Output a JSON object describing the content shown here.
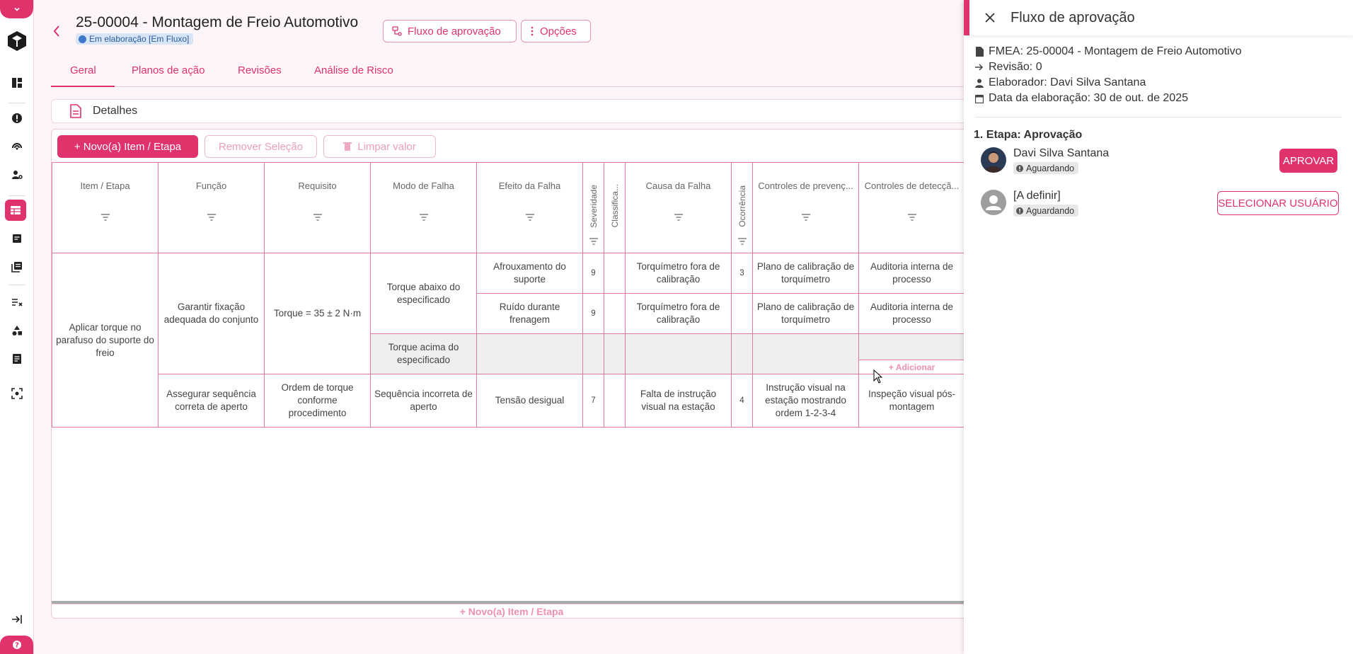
{
  "colors": {
    "accent": "#e0336b",
    "border": "#e694b0",
    "status_badge": "#d8e5f7"
  },
  "header": {
    "title": "25-00004 - Montagem de Freio Automotivo",
    "status": "Em elaboração [Em Fluxo]",
    "approval_flow_button": "Fluxo de aprovação",
    "options_button": "Opções"
  },
  "tabs": [
    {
      "label": "Geral",
      "active": true
    },
    {
      "label": "Planos de ação",
      "active": false
    },
    {
      "label": "Revisões",
      "active": false
    },
    {
      "label": "Análise de Risco",
      "active": false
    }
  ],
  "details": {
    "label": "Detalhes"
  },
  "toolbar": {
    "new_item": "+ Novo(a) Item / Etapa",
    "remove_selection": "Remover Seleção",
    "clear_value": "Limpar valor"
  },
  "table": {
    "columns": [
      "Item / Etapa",
      "Função",
      "Requisito",
      "Modo de Falha",
      "Efeito da Falha",
      "Severidade",
      "Classifica...",
      "Causa da Falha",
      "Ocorrência",
      "Controles de prevenç...",
      "Controles de detecçã..."
    ],
    "item": "Aplicar torque no parafuso do suporte do freio",
    "func1": "Garantir fixação adequada do conjunto",
    "req1": "Torque = 35 ± 2 N·m",
    "mode1": "Torque abaixo do especificado",
    "mode2": "Torque acima do especificado",
    "row1": {
      "effect": "Afrouxamento do suporte",
      "sev": "9",
      "cause": "Torquímetro fora de calibração",
      "occ": "3",
      "prev": "Plano de calibração de torquímetro",
      "det": "Auditoria interna de processo"
    },
    "row2": {
      "effect": "Ruído durante frenagem",
      "sev": "9",
      "cause": "Torquímetro fora de calibração",
      "occ": "",
      "prev": "Plano de calibração de torquímetro",
      "det": "Auditoria interna de processo"
    },
    "add_label": "+ Adicionar",
    "row4": {
      "func": "Assegurar sequência correta de aperto",
      "req": "Ordem de torque conforme procedimento",
      "mode": "Sequência incorreta de aperto",
      "effect": "Tensão desigual",
      "sev": "7",
      "cause": "Falta de instrução visual na estação",
      "occ": "4",
      "prev": "Instrução visual na estação mostrando ordem 1-2-3-4",
      "det": "Inspeção visual pós-montagem"
    }
  },
  "bottom_add": "+ Novo(a) Item / Etapa",
  "drawer": {
    "title": "Fluxo de aprovação",
    "fmea": "FMEA: 25-00004 - Montagem de Freio Automotivo",
    "revision": "Revisão: 0",
    "author": "Elaborador: Davi Silva Santana",
    "date": "Data da elaboração: 30 de out. de 2025",
    "stage": "1. Etapa: Aprovação",
    "approvers": [
      {
        "name": "Davi Silva Santana",
        "status": "Aguardando",
        "action": "APROVAR"
      },
      {
        "name": "[A definir]",
        "status": "Aguardando",
        "action": "SELECIONAR USUÁRIO"
      }
    ]
  }
}
